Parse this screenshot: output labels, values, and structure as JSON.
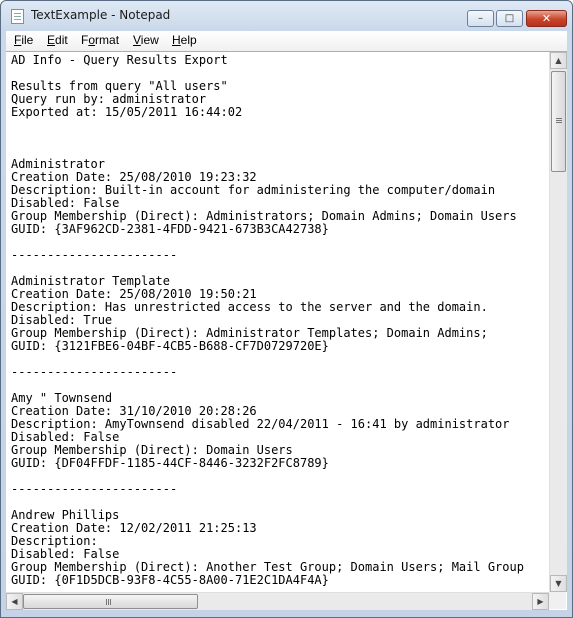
{
  "window": {
    "title": "TextExample - Notepad",
    "controls": {
      "minimize": "–",
      "maximize": "□",
      "close": "✕"
    }
  },
  "menu": [
    {
      "key": "F",
      "rest": "ile"
    },
    {
      "key": "E",
      "rest": "dit"
    },
    {
      "key": "o",
      "before": "F",
      "rest": "rmat"
    },
    {
      "key": "V",
      "rest": "iew"
    },
    {
      "key": "H",
      "rest": "elp"
    }
  ],
  "document": {
    "lines": [
      "AD Info - Query Results Export",
      "",
      "Results from query \"All users\"",
      "Query run by: administrator",
      "Exported at: 15/05/2011 16:44:02",
      "",
      "",
      "",
      "Administrator",
      "Creation Date: 25/08/2010 19:23:32",
      "Description: Built-in account for administering the computer/domain",
      "Disabled: False",
      "Group Membership (Direct): Administrators; Domain Admins; Domain Users",
      "GUID: {3AF962CD-2381-4FDD-9421-673B3CA42738}",
      "",
      "-----------------------",
      "",
      "Administrator Template",
      "Creation Date: 25/08/2010 19:50:21",
      "Description: Has unrestricted access to the server and the domain.",
      "Disabled: True",
      "Group Membership (Direct): Administrator Templates; Domain Admins;",
      "GUID: {3121FBE6-04BF-4CB5-B688-CF7D0729720E}",
      "",
      "-----------------------",
      "",
      "Amy \" Townsend",
      "Creation Date: 31/10/2010 20:28:26",
      "Description: AmyTownsend disabled 22/04/2011 - 16:41 by administrator",
      "Disabled: False",
      "Group Membership (Direct): Domain Users",
      "GUID: {DF04FFDF-1185-44CF-8446-3232F2FC8789}",
      "",
      "-----------------------",
      "",
      "Andrew Phillips",
      "Creation Date: 12/02/2011 21:25:13",
      "Description:",
      "Disabled: False",
      "Group Membership (Direct): Another Test Group; Domain Users; Mail Group",
      "GUID: {0F1D5DCB-93F8-4C55-8A00-71E2C1DA4F4A}"
    ],
    "caret_line": 8
  },
  "icons": {
    "app": "notepad-icon",
    "up": "▲",
    "down": "▼",
    "left": "◀",
    "right": "▶"
  }
}
